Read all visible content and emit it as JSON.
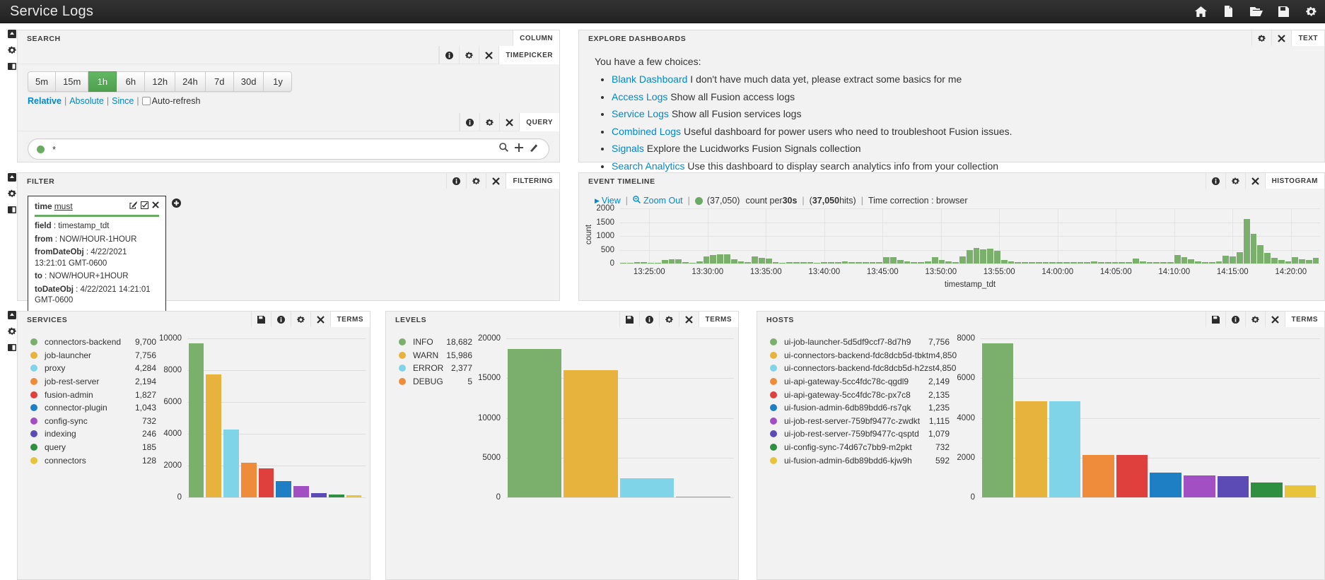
{
  "header": {
    "title": "Service Logs",
    "icons": [
      "home-icon",
      "file-icon",
      "folder-open-icon",
      "save-icon",
      "gear-icon"
    ]
  },
  "rail": {
    "icons": [
      "collapse-icon",
      "gear-icon",
      "panel-icon"
    ]
  },
  "search_panel": {
    "title": "SEARCH",
    "tag": "COLUMN",
    "timepicker": {
      "tag": "TIMEPICKER",
      "options": [
        "5m",
        "15m",
        "1h",
        "6h",
        "12h",
        "24h",
        "7d",
        "30d",
        "1y"
      ],
      "active": "1h",
      "modes": [
        "Relative",
        "Absolute",
        "Since"
      ],
      "active_mode": "Relative",
      "autorefresh_label": "Auto-refresh",
      "autorefresh_checked": false
    },
    "query": {
      "tag": "QUERY",
      "value": "*",
      "placeholder": "*",
      "dot_color": "#6aab63"
    }
  },
  "explore_panel": {
    "title": "EXPLORE DASHBOARDS",
    "tag": "TEXT",
    "lead": "You have a few choices:",
    "items": [
      {
        "link": "Blank Dashboard",
        "text": " I don't have much data yet, please extract some basics for me"
      },
      {
        "link": "Access Logs",
        "text": " Show all Fusion access logs"
      },
      {
        "link": "Service Logs",
        "text": " Show all Fusion services logs"
      },
      {
        "link": "Combined Logs",
        "text": " Useful dashboard for power users who need to troubleshoot Fusion issues."
      },
      {
        "link": "Signals",
        "text": " Explore the Lucidworks Fusion Signals collection"
      },
      {
        "link": "Search Analytics",
        "text": " Use this dashboard to display search analytics info from your collection"
      }
    ]
  },
  "filter_panel": {
    "title": "FILTER",
    "tag": "FILTERING",
    "card": {
      "name": "time",
      "type": "must",
      "rows": [
        {
          "key": "field",
          "value": "timestamp_tdt"
        },
        {
          "key": "from",
          "value": "NOW/HOUR-1HOUR"
        },
        {
          "key": "fromDateObj",
          "value": "4/22/2021 13:21:01 GMT-0600"
        },
        {
          "key": "to",
          "value": "NOW/HOUR+1HOUR"
        },
        {
          "key": "toDateObj",
          "value": "4/22/2021 14:21:01 GMT-0600"
        }
      ]
    }
  },
  "timeline_panel": {
    "title": "EVENT TIMELINE",
    "tag": "HISTOGRAM",
    "view_label": "View",
    "zoom_out_label": "Zoom Out",
    "count_label": "(37,050)",
    "per_label_pre": "count per ",
    "per_label_bold": "30s",
    "hits_bold": "37,050",
    "hits_suffix": " hits)",
    "hits_prefix": "(",
    "time_correction": "Time correction : browser"
  },
  "services_panel": {
    "title": "SERVICES",
    "tag": "TERMS"
  },
  "levels_panel": {
    "title": "LEVELS",
    "tag": "TERMS"
  },
  "hosts_panel": {
    "title": "HOSTS",
    "tag": "TERMS"
  },
  "chart_data": [
    {
      "id": "event_timeline",
      "type": "bar",
      "title": "EVENT TIMELINE",
      "xlabel": "timestamp_tdt",
      "ylabel": "count",
      "ylim": [
        0,
        2000
      ],
      "yticks": [
        0,
        500,
        1000,
        1500,
        2000
      ],
      "xticks": [
        "13:25:00",
        "13:30:00",
        "13:35:00",
        "13:40:00",
        "13:45:00",
        "13:50:00",
        "13:55:00",
        "14:00:00",
        "14:05:00",
        "14:10:00",
        "14:15:00",
        "14:20:00"
      ],
      "color": "#7ab06b",
      "grid": true,
      "legend": "(37,050) count per 30s",
      "total_hits": 37050,
      "interval": "30s",
      "values": [
        30,
        25,
        40,
        60,
        35,
        30,
        140,
        160,
        150,
        40,
        30,
        70,
        260,
        300,
        340,
        330,
        150,
        80,
        60,
        250,
        210,
        180,
        40,
        30,
        40,
        60,
        50,
        40,
        30,
        50,
        40,
        60,
        70,
        60,
        50,
        40,
        60,
        50,
        240,
        230,
        120,
        90,
        60,
        50,
        90,
        220,
        140,
        90,
        60,
        250,
        500,
        560,
        520,
        540,
        460,
        140,
        90,
        60,
        40,
        50,
        60,
        50,
        40,
        60,
        50,
        40,
        60,
        50,
        70,
        60,
        50,
        40,
        60,
        50,
        180,
        80,
        60,
        50,
        40,
        60,
        300,
        230,
        150,
        90,
        60,
        50,
        80,
        280,
        250,
        420,
        1620,
        1080,
        660,
        380,
        200,
        120,
        90,
        220,
        160,
        120,
        200
      ]
    },
    {
      "id": "services",
      "type": "bar",
      "title": "SERVICES",
      "ylim": [
        0,
        10000
      ],
      "yticks": [
        0,
        2000,
        4000,
        6000,
        8000,
        10000
      ],
      "categories": [
        "connectors-backend",
        "job-launcher",
        "proxy",
        "job-rest-server",
        "fusion-admin",
        "connector-plugin",
        "config-sync",
        "indexing",
        "query",
        "connectors"
      ],
      "values": [
        9700,
        7756,
        4284,
        2194,
        1827,
        1043,
        732,
        246,
        185,
        128
      ],
      "value_labels": [
        "9,700",
        "7,756",
        "4,284",
        "2,194",
        "1,827",
        "1,043",
        "732",
        "246",
        "185",
        "128"
      ],
      "colors": [
        "#7ab06b",
        "#e8b33d",
        "#7fd4e8",
        "#ef8c3c",
        "#e0403d",
        "#1f7fc4",
        "#a34fc4",
        "#5c4bb5",
        "#2d8f3f",
        "#e8c43d"
      ]
    },
    {
      "id": "levels",
      "type": "bar",
      "title": "LEVELS",
      "ylim": [
        0,
        20000
      ],
      "yticks": [
        0,
        5000,
        10000,
        15000,
        20000
      ],
      "categories": [
        "INFO",
        "WARN",
        "ERROR",
        "DEBUG"
      ],
      "values": [
        18682,
        15986,
        2377,
        5
      ],
      "value_labels": [
        "18,682",
        "15,986",
        "2,377",
        "5"
      ],
      "colors": [
        "#7ab06b",
        "#e8b33d",
        "#7fd4e8",
        "#ef8c3c"
      ]
    },
    {
      "id": "hosts",
      "type": "bar",
      "title": "HOSTS",
      "ylim": [
        0,
        8000
      ],
      "yticks": [
        0,
        2000,
        4000,
        6000,
        8000
      ],
      "categories": [
        "ui-job-launcher-5d5df9ccf7-8d7h9",
        "ui-connectors-backend-fdc8dcb5d-tbktm",
        "ui-connectors-backend-fdc8dcb5d-h2zst",
        "ui-api-gateway-5cc4fdc78c-qgdl9",
        "ui-api-gateway-5cc4fdc78c-px7c8",
        "ui-fusion-admin-6db89bdd6-rs7qk",
        "ui-job-rest-server-759bf9477c-zwdkt",
        "ui-job-rest-server-759bf9477c-qsptd",
        "ui-config-sync-74d67c7bb9-m2pkt",
        "ui-fusion-admin-6db89bdd6-kjw9h"
      ],
      "values": [
        7756,
        4850,
        4850,
        2149,
        2135,
        1235,
        1115,
        1079,
        732,
        592
      ],
      "value_labels": [
        "7,756",
        "4,850",
        "4,850",
        "2,149",
        "2,135",
        "1,235",
        "1,115",
        "1,079",
        "732",
        "592"
      ],
      "colors": [
        "#7ab06b",
        "#e8b33d",
        "#7fd4e8",
        "#ef8c3c",
        "#e0403d",
        "#1f7fc4",
        "#a34fc4",
        "#5c4bb5",
        "#2d8f3f",
        "#e8c43d"
      ]
    }
  ]
}
